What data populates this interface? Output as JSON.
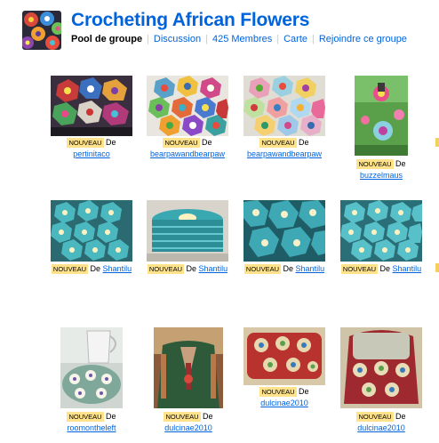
{
  "group": {
    "title": "Crocheting African Flowers",
    "nav": {
      "pool": "Pool de groupe",
      "discussion": "Discussion",
      "members": "425 Membres",
      "map": "Carte",
      "join": "Rejoindre ce groupe"
    }
  },
  "labels": {
    "new_badge": "NOUVEAU",
    "by": "De"
  },
  "photos": [
    {
      "user": "pertinitaco"
    },
    {
      "user": "bearpawandbearpaw"
    },
    {
      "user": "bearpawandbearpaw"
    },
    {
      "user": "buzzelmaus"
    },
    {
      "user": "Shantilu"
    },
    {
      "user": "Shantilu"
    },
    {
      "user": "Shantilu"
    },
    {
      "user": "Shantilu"
    },
    {
      "user": "roomontheleft"
    },
    {
      "user": "dulcinae2010"
    },
    {
      "user": "dulcinae2010"
    },
    {
      "user": "dulcinae2010"
    }
  ],
  "colors": {
    "link": "#0063dc",
    "badge": "#ffe28a"
  }
}
